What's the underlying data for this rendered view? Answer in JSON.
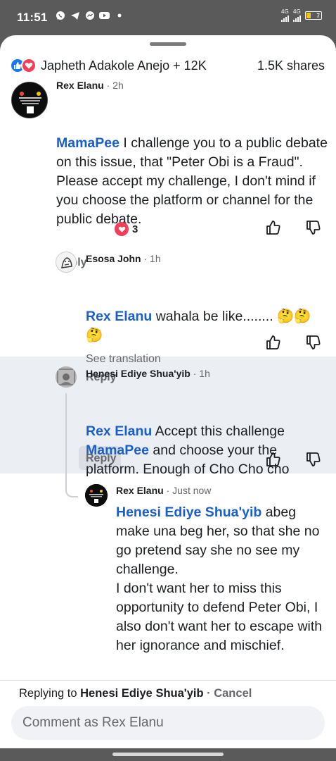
{
  "status_bar": {
    "time": "11:51",
    "left_icons": [
      "whatsapp-icon",
      "telegram-icon",
      "messenger-icon",
      "youtube-icon",
      "dot-icon"
    ],
    "net1": "4G",
    "net2": "4G",
    "battery": "7",
    "battery_color": "#f5c518"
  },
  "reactions": {
    "summary": "Japheth Adakole Anejo + 12K",
    "shares": "1.5K shares"
  },
  "comments": [
    {
      "author": "Rex Elanu",
      "time": "2h",
      "mention": "MamaPee",
      "text": " I challenge you to a public debate on this issue, that \"Peter Obi is a Fraud\".",
      "text2": "Please accept my challenge, I don't mind if you choose the platform or channel for the public debate.",
      "reply_label": "Reply",
      "love_count": "3"
    },
    {
      "author": "Esosa John",
      "time": "1h",
      "mention": "Rex Elanu",
      "text": " wahala be like........ 🤔🤔",
      "text2": "🤔",
      "translation": "See translation",
      "reply_label": "Reply"
    },
    {
      "author": "Henesi Ediye Shua'yib",
      "time": "1h",
      "mention": "Rex Elanu",
      "text": " Accept this challenge",
      "mention2": "MamaPee",
      "text2": " and choose your the platform. Enough of Cho Cho cho",
      "reply_label": "Reply"
    },
    {
      "author": "Rex Elanu",
      "time": "Just now",
      "mention": "Henesi Ediye Shua'yib",
      "text": " abeg make una beg her, so that she no go pretend say she no see my challenge.",
      "text2": "I don't want her to miss this opportunity to defend Peter Obi, I also don't want her to escape with her ignorance and mischief."
    }
  ],
  "footer": {
    "replying_prefix": "Replying to ",
    "replying_name": "Henesi Ediye Shua'yib",
    "cancel": "Cancel",
    "placeholder": "Comment as Rex Elanu"
  },
  "colors": {
    "mention": "#1a5fc7",
    "like_blue": "#1877f2",
    "love_red": "#f33e58",
    "highlight": "#ebeef3"
  }
}
